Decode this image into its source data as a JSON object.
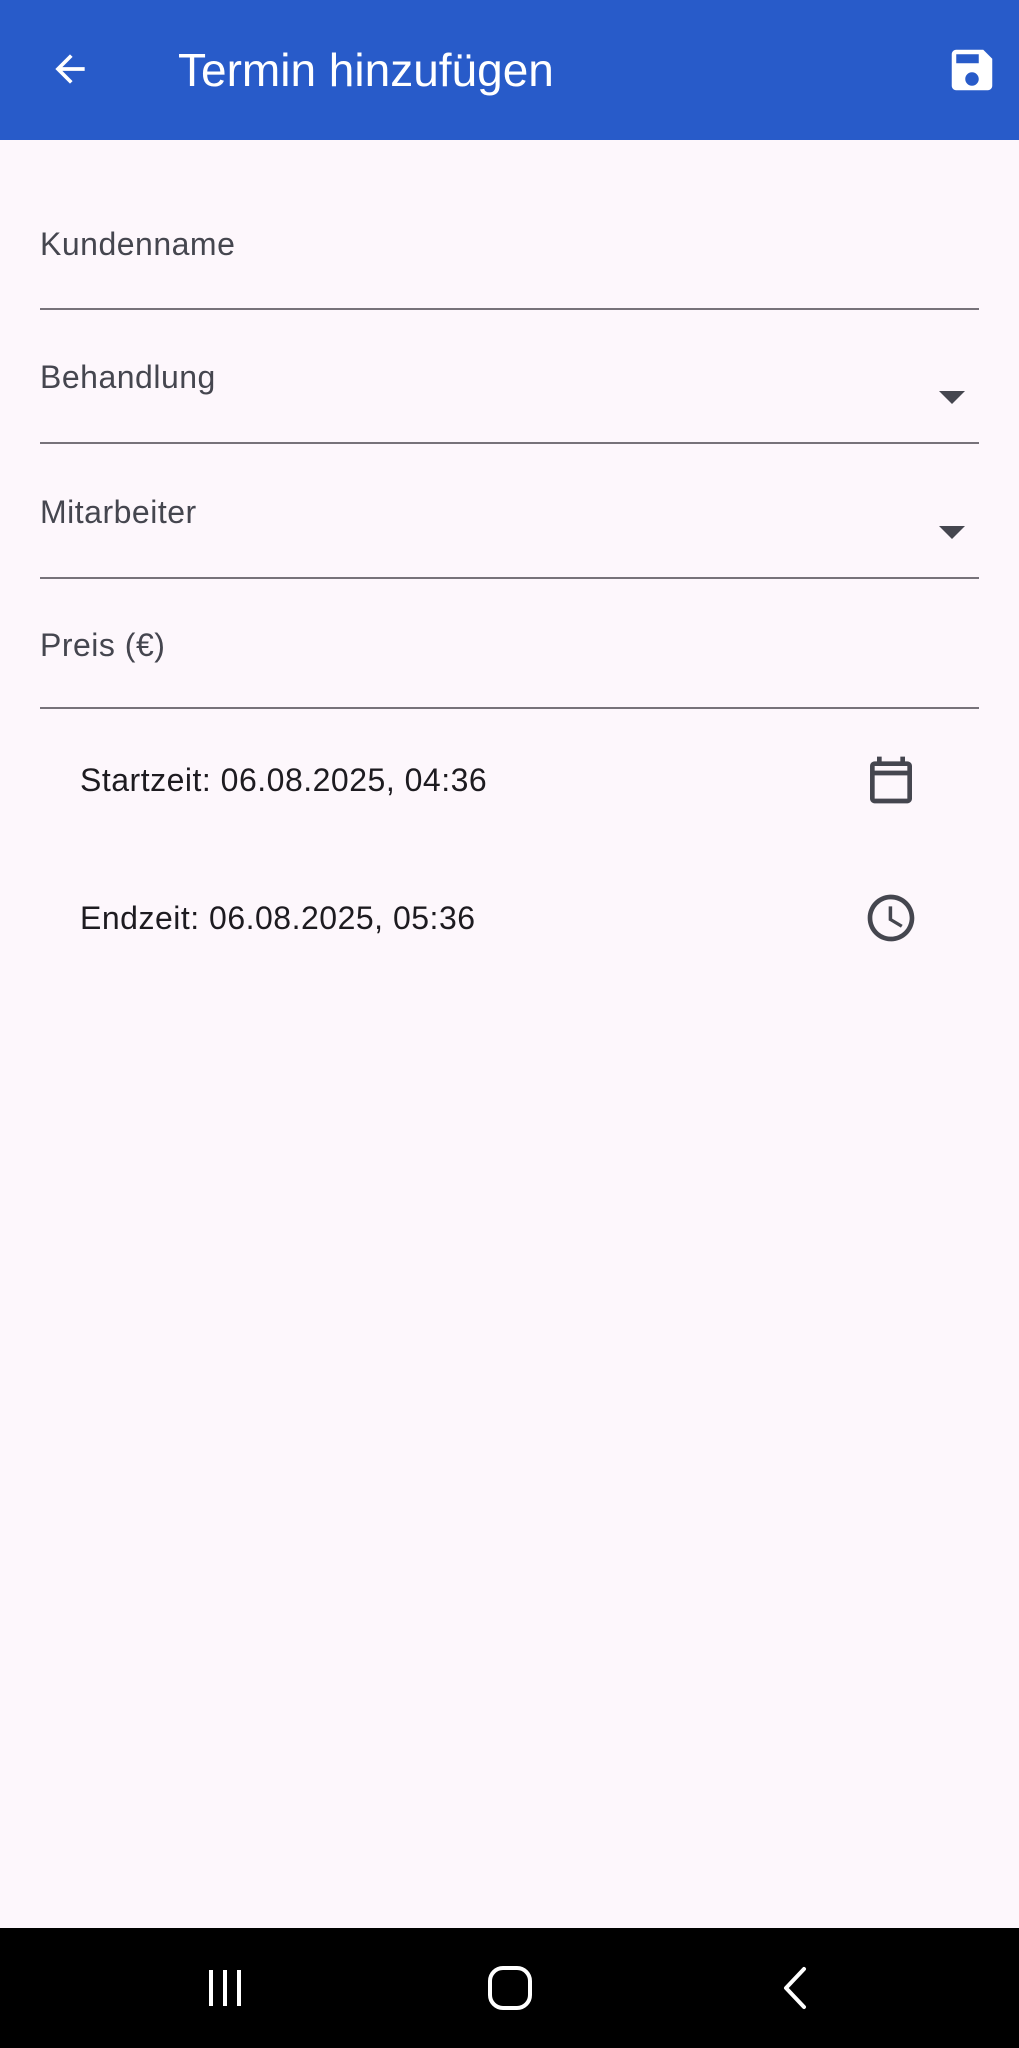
{
  "app_bar": {
    "title": "Termin hinzufügen",
    "back_icon": "arrow-back-icon",
    "save_icon": "save-icon",
    "background_color": "#285bc9",
    "foreground_color": "#ffffff"
  },
  "form": {
    "customer_name": {
      "label": "Kundenname"
    },
    "treatment": {
      "label": "Behandlung",
      "icon": "dropdown-arrow-icon"
    },
    "employee": {
      "label": "Mitarbeiter",
      "icon": "dropdown-arrow-icon"
    },
    "price": {
      "label": "Preis (€)"
    },
    "start_time": {
      "text": "Startzeit: 06.08.2025, 04:36",
      "icon": "calendar-icon"
    },
    "end_time": {
      "text": "Endzeit: 06.08.2025, 05:36",
      "icon": "clock-icon"
    }
  },
  "system_nav": {
    "recents_icon": "recent-apps-icon",
    "home_icon": "home-icon",
    "back_icon": "back-chevron-icon"
  },
  "colors": {
    "background": "#fdf7fc",
    "label_text": "#45464f",
    "body_text": "#1d1b20",
    "underline": "#77727a"
  }
}
